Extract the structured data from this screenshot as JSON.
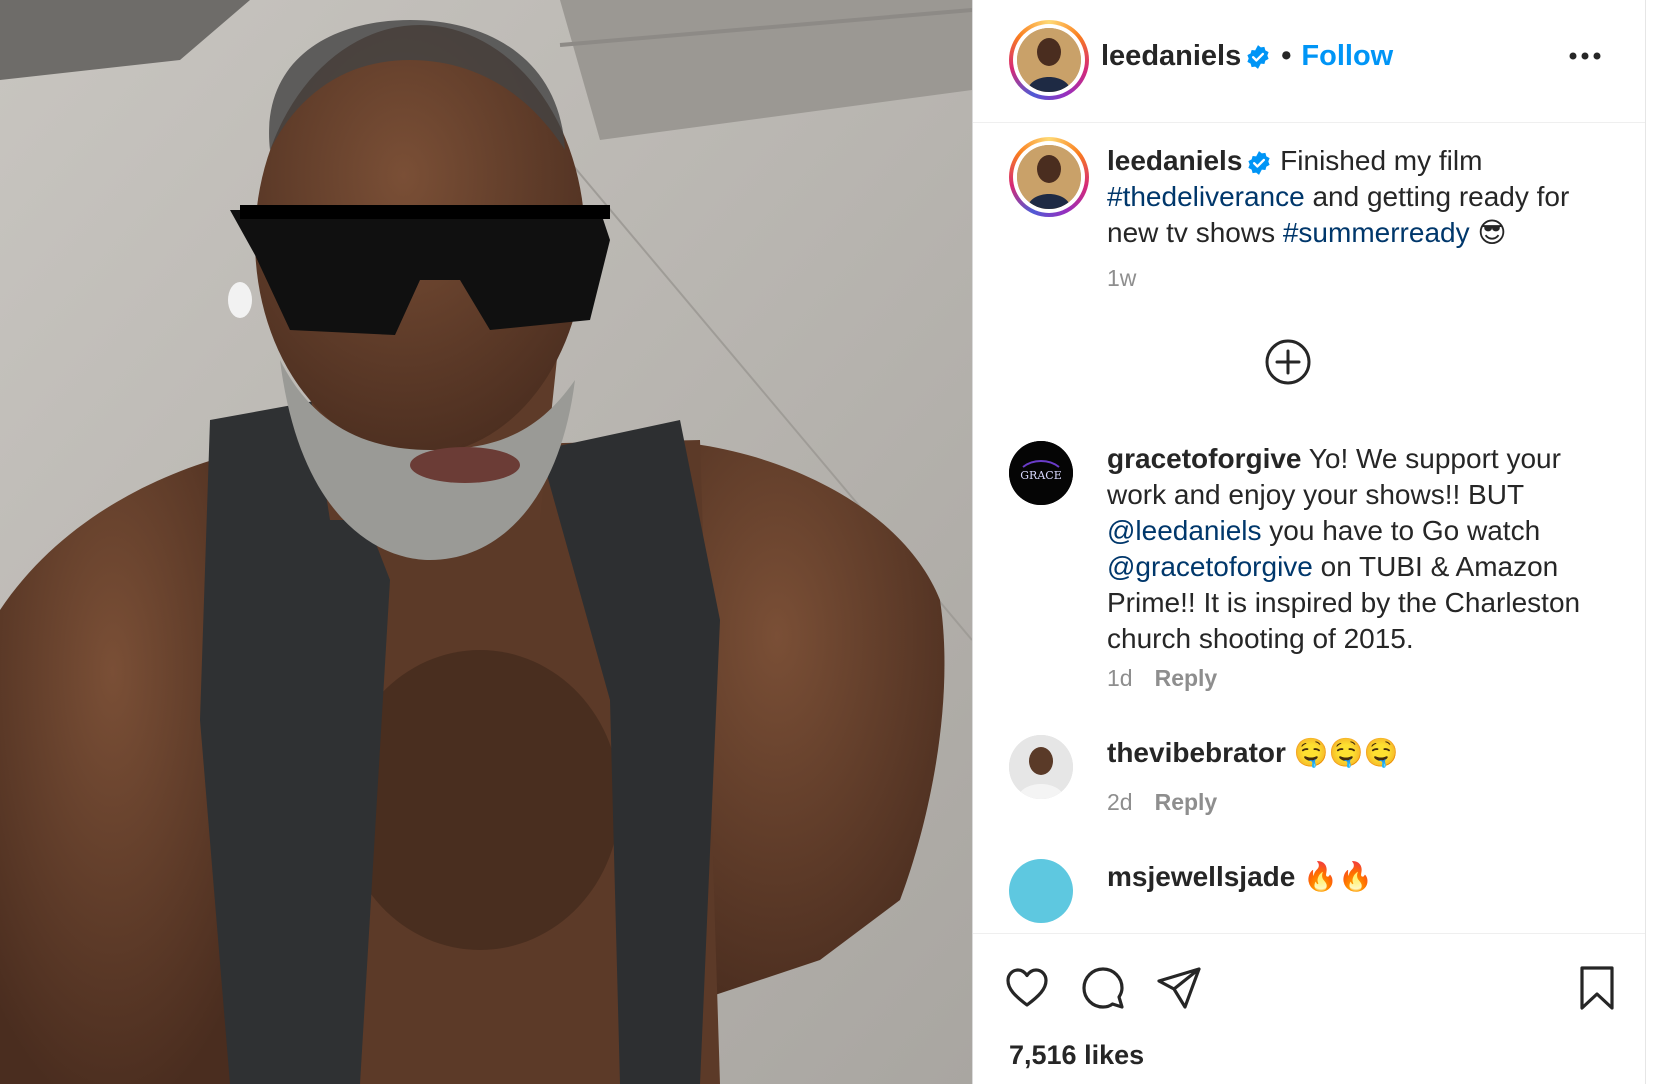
{
  "post": {
    "author": "leedaniels",
    "follow_label": "Follow",
    "separator": "•",
    "caption": {
      "text_1": " Finished my film ",
      "hashtag_1": "#thedeliverance",
      "text_2": " and getting ready for new tv shows ",
      "hashtag_2": "#summerready",
      "emoji": "😎",
      "time": "1w"
    },
    "likes": "7,516 likes"
  },
  "comments": [
    {
      "user": "gracetoforgive",
      "text_1": " Yo! We support your work and enjoy your shows!! BUT ",
      "mention_1": "@leedaniels",
      "text_2": " you have to Go watch ",
      "mention_2": "@gracetoforgive",
      "text_3": " on TUBI & Amazon Prime!! It is inspired by the Charleston church shooting of 2015.",
      "time": "1d",
      "reply_label": "Reply",
      "avatar_text": "GRACE"
    },
    {
      "user": "thevibebrator",
      "text_1": " 🤤🤤🤤",
      "time": "2d",
      "reply_label": "Reply"
    },
    {
      "user": "msjewellsjade",
      "text_1": " 🔥🔥"
    }
  ],
  "icons": {
    "more": "more-options-icon",
    "verified": "verified-badge-icon",
    "add": "add-comment-circle-icon",
    "like": "heart-icon",
    "comment": "comment-bubble-icon",
    "share": "paper-plane-icon",
    "save": "bookmark-icon"
  },
  "colors": {
    "link_blue": "#0095f6",
    "hashtag": "#00376b",
    "muted": "#8e8e8e",
    "text": "#262626"
  }
}
